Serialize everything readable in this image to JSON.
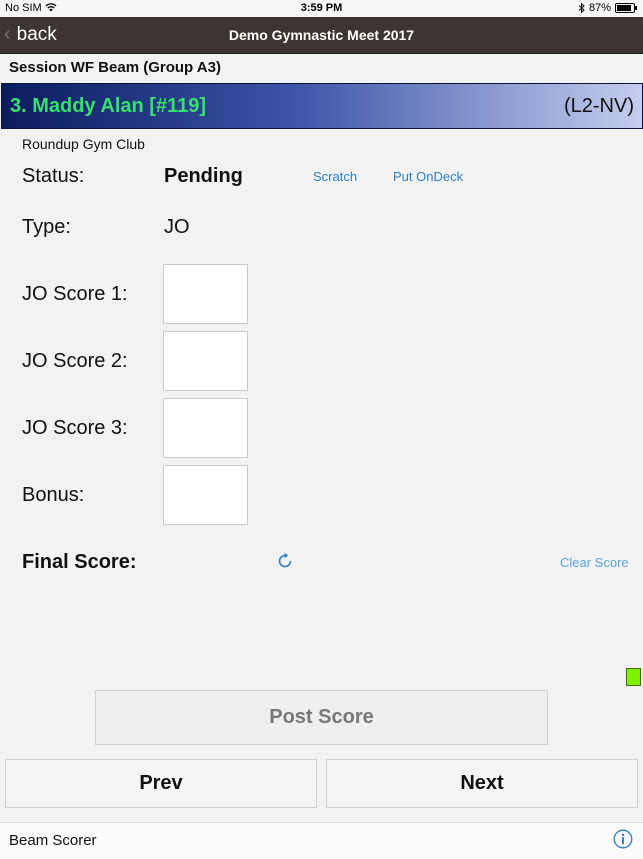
{
  "status_bar": {
    "carrier": "No SIM",
    "time": "3:59 PM",
    "battery": "87%",
    "battery_level": 0.87
  },
  "nav": {
    "back_label": "back",
    "title": "Demo Gymnastic Meet 2017"
  },
  "session": "Session WF Beam (Group A3)",
  "athlete": {
    "name": "3. Maddy Alan [#119]",
    "level": "(L2-NV)",
    "club": "Roundup Gym Club"
  },
  "status": {
    "label": "Status:",
    "value": "Pending",
    "scratch": "Scratch",
    "ondeck": "Put OnDeck"
  },
  "type": {
    "label": "Type:",
    "value": "JO"
  },
  "scores": {
    "jo1_label": "JO Score 1:",
    "jo2_label": "JO Score 2:",
    "jo3_label": "JO Score 3:",
    "bonus_label": "Bonus:",
    "jo1": "",
    "jo2": "",
    "jo3": "",
    "bonus": ""
  },
  "final": {
    "label": "Final Score:",
    "clear": "Clear Score"
  },
  "buttons": {
    "post": "Post Score",
    "prev": "Prev",
    "next": "Next"
  },
  "footer": {
    "title": "Beam Scorer"
  },
  "colors": {
    "accent": "#2a7fc1",
    "navbar": "#3d3533",
    "athlete_name": "#36e06c",
    "indicator": "#7ef000"
  }
}
